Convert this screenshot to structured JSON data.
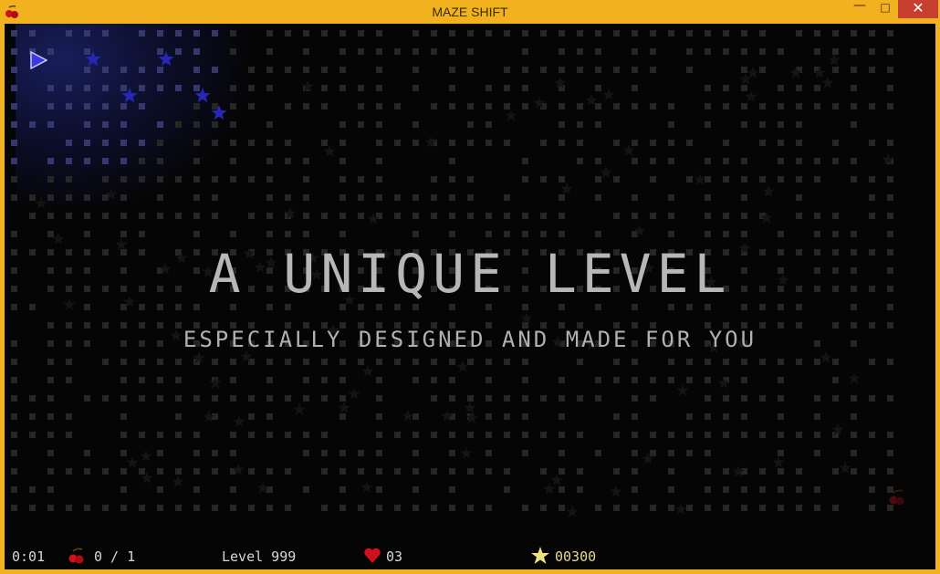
{
  "window": {
    "title": "MAZE SHIFT",
    "minimize_label": "—",
    "maximize_label": "□",
    "close_label": "✕"
  },
  "overlay": {
    "title": "A UNIQUE LEVEL",
    "subtitle": "ESPECIALLY DESIGNED AND MADE FOR YOU"
  },
  "hud": {
    "time": "0:01",
    "cherries": "0 / 1",
    "level": "Level 999",
    "lives": "03",
    "score": "00300"
  },
  "icons": {
    "app": "cherry-icon",
    "player": "player-arrow-icon",
    "cherry": "cherry-icon",
    "heart": "heart-icon",
    "star": "star-icon"
  },
  "colors": {
    "window_frame": "#f2b11f",
    "background": "#050505",
    "maze_dot": "#262626",
    "player": "#3a3ae0",
    "star_lit": "#2727b5",
    "heart": "#d0101a",
    "score_star": "#f0e080",
    "text": "#b7b7b7"
  }
}
